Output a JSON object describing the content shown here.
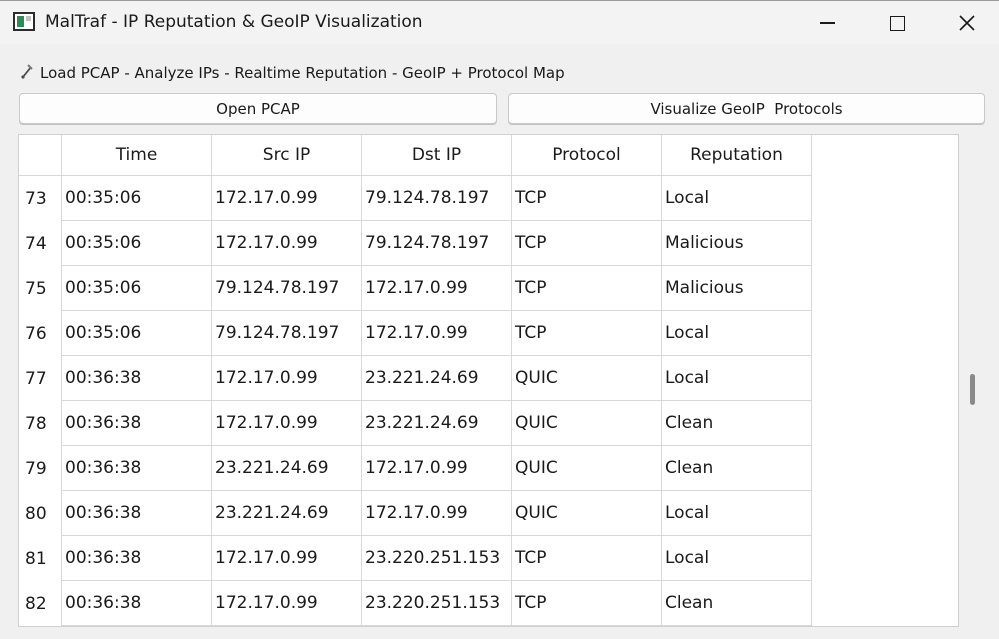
{
  "window": {
    "title": "MalTraf - IP Reputation & GeoIP Visualization",
    "icon": "app-window-icon"
  },
  "subheader": {
    "icon": "satellite-icon",
    "text": "Load PCAP - Analyze IPs - Realtime Reputation - GeoIP + Protocol Map"
  },
  "toolbar": {
    "open_label": "Open PCAP",
    "visualize_label": "Visualize GeoIP  Protocols"
  },
  "table": {
    "columns": [
      "Time",
      "Src IP",
      "Dst IP",
      "Protocol",
      "Reputation"
    ],
    "rows": [
      {
        "n": "73",
        "time": "00:35:06",
        "src": "172.17.0.99",
        "dst": "79.124.78.197",
        "protocol": "TCP",
        "reputation": "Local"
      },
      {
        "n": "74",
        "time": "00:35:06",
        "src": "172.17.0.99",
        "dst": "79.124.78.197",
        "protocol": "TCP",
        "reputation": "Malicious"
      },
      {
        "n": "75",
        "time": "00:35:06",
        "src": "79.124.78.197",
        "dst": "172.17.0.99",
        "protocol": "TCP",
        "reputation": "Malicious"
      },
      {
        "n": "76",
        "time": "00:35:06",
        "src": "79.124.78.197",
        "dst": "172.17.0.99",
        "protocol": "TCP",
        "reputation": "Local"
      },
      {
        "n": "77",
        "time": "00:36:38",
        "src": "172.17.0.99",
        "dst": "23.221.24.69",
        "protocol": "QUIC",
        "reputation": "Local"
      },
      {
        "n": "78",
        "time": "00:36:38",
        "src": "172.17.0.99",
        "dst": "23.221.24.69",
        "protocol": "QUIC",
        "reputation": "Clean"
      },
      {
        "n": "79",
        "time": "00:36:38",
        "src": "23.221.24.69",
        "dst": "172.17.0.99",
        "protocol": "QUIC",
        "reputation": "Clean"
      },
      {
        "n": "80",
        "time": "00:36:38",
        "src": "23.221.24.69",
        "dst": "172.17.0.99",
        "protocol": "QUIC",
        "reputation": "Local"
      },
      {
        "n": "81",
        "time": "00:36:38",
        "src": "172.17.0.99",
        "dst": "23.220.251.153",
        "protocol": "TCP",
        "reputation": "Local"
      },
      {
        "n": "82",
        "time": "00:36:38",
        "src": "172.17.0.99",
        "dst": "23.220.251.153",
        "protocol": "TCP",
        "reputation": "Clean"
      }
    ]
  },
  "scroll": {
    "position": 0.5
  }
}
